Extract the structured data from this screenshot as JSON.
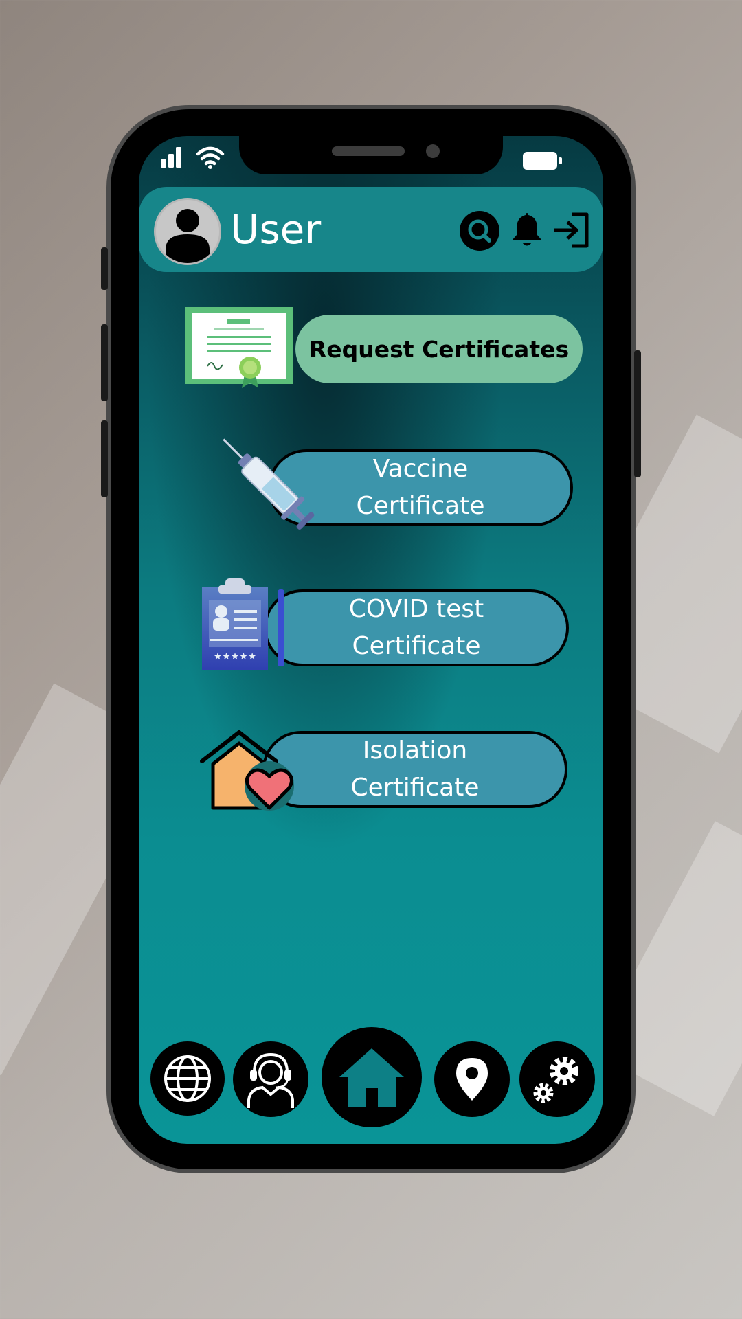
{
  "header": {
    "title": "User"
  },
  "request": {
    "label": "Request Certificates"
  },
  "certificates": [
    {
      "label": "Vaccine\nCertificate"
    },
    {
      "label": "COVID test\nCertificate"
    },
    {
      "label": "Isolation\nCertificate"
    }
  ],
  "icons": {
    "status": [
      "signal-icon",
      "wifi-icon",
      "battery-icon"
    ],
    "header": [
      "search-icon",
      "bell-icon",
      "logout-icon"
    ],
    "nav": [
      "globe-icon",
      "support-agent-icon",
      "home-icon",
      "location-pin-icon",
      "settings-gears-icon"
    ]
  },
  "colors": {
    "header_bg": "#17868a",
    "request_pill": "#7cc3a0",
    "cert_pill": "#3c95ab",
    "screen_top": "#063a42",
    "screen_bottom": "#0a9497"
  }
}
